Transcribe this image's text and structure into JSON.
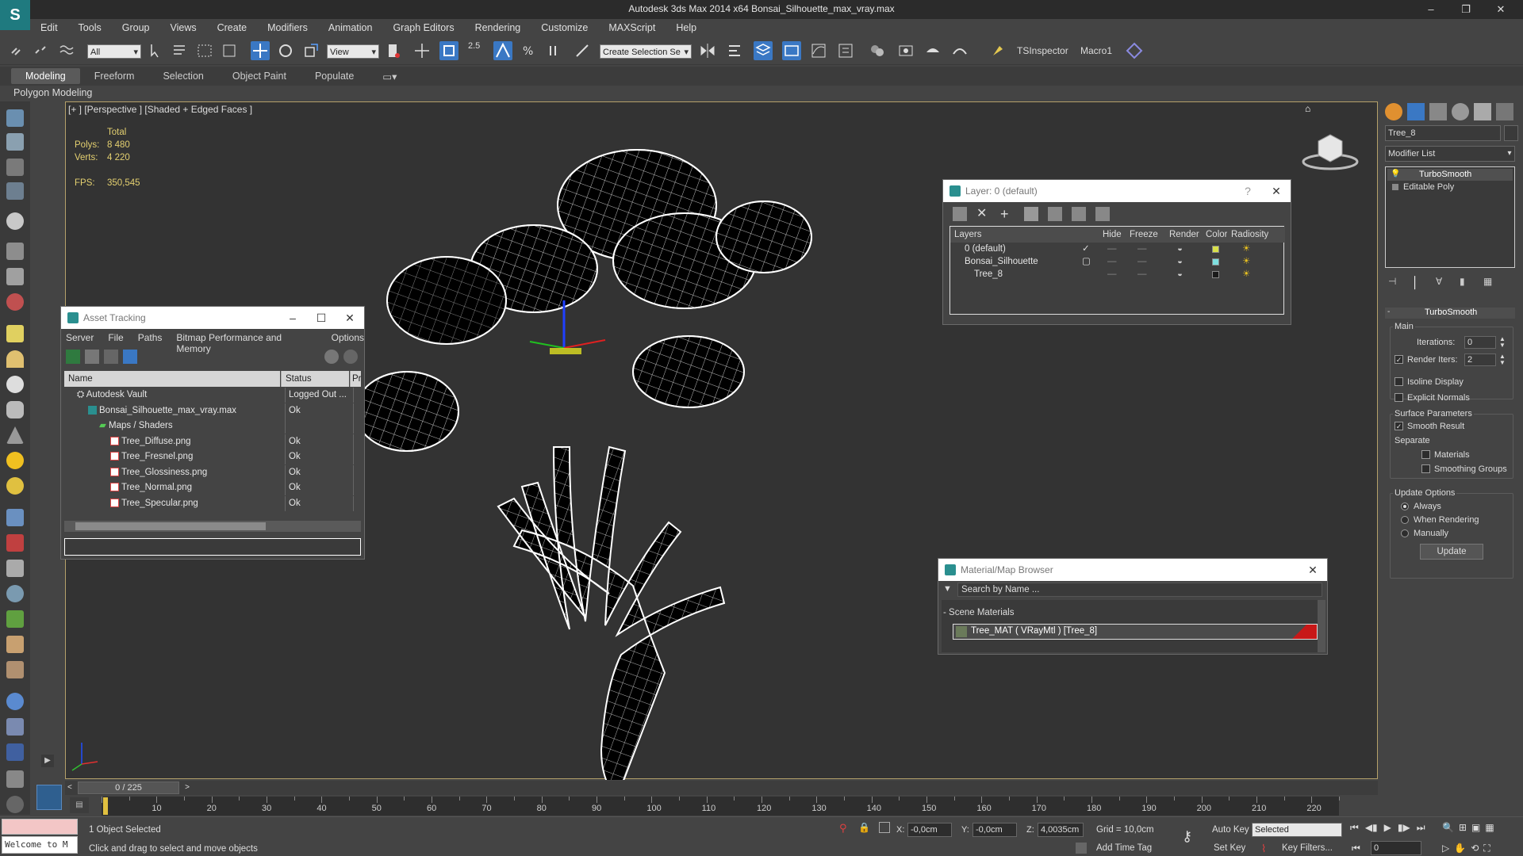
{
  "window": {
    "title": "Autodesk 3ds Max  2014 x64     Bonsai_Silhouette_max_vray.max",
    "minimize": "–",
    "restore": "❐",
    "close": "✕"
  },
  "menu": [
    "Edit",
    "Tools",
    "Group",
    "Views",
    "Create",
    "Modifiers",
    "Animation",
    "Graph Editors",
    "Rendering",
    "Customize",
    "MAXScript",
    "Help"
  ],
  "toolbar": {
    "filter_select": "All",
    "ref_coord_select": "View",
    "snap_label": "2.5",
    "selection_set_placeholder": "Create Selection Se",
    "tsinspector": "TSInspector",
    "macro1": "Macro1"
  },
  "ribbon": {
    "tabs": [
      "Modeling",
      "Freeform",
      "Selection",
      "Object Paint",
      "Populate"
    ],
    "active_tab": "Modeling",
    "sub_label": "Polygon Modeling"
  },
  "viewport": {
    "label": "[+ ] [Perspective ] [Shaded + Edged Faces ]",
    "stats": {
      "total_label": "Total",
      "polys_label": "Polys:",
      "polys_value": "8 480",
      "verts_label": "Verts:",
      "verts_value": "4 220",
      "fps_label": "FPS:",
      "fps_value": "350,545"
    }
  },
  "asset_tracking": {
    "title": "Asset Tracking",
    "menu": [
      "Server",
      "File",
      "Paths",
      "Bitmap Performance and Memory",
      "Options"
    ],
    "columns": [
      "Name",
      "Status",
      "Pr"
    ],
    "rows": [
      {
        "name": "Autodesk Vault",
        "status": "Logged Out ...",
        "indent": 0
      },
      {
        "name": "Bonsai_Silhouette_max_vray.max",
        "status": "Ok",
        "indent": 1
      },
      {
        "name": "Maps / Shaders",
        "status": "",
        "indent": 2
      },
      {
        "name": "Tree_Diffuse.png",
        "status": "Ok",
        "indent": 3
      },
      {
        "name": "Tree_Fresnel.png",
        "status": "Ok",
        "indent": 3
      },
      {
        "name": "Tree_Glossiness.png",
        "status": "Ok",
        "indent": 3
      },
      {
        "name": "Tree_Normal.png",
        "status": "Ok",
        "indent": 3
      },
      {
        "name": "Tree_Specular.png",
        "status": "Ok",
        "indent": 3
      }
    ]
  },
  "layer_window": {
    "title": "Layer: 0 (default)",
    "help": "?",
    "columns": [
      "Layers",
      "Hide",
      "Freeze",
      "Render",
      "Color",
      "Radiosity"
    ],
    "rows": [
      {
        "name": "0 (default)",
        "color": "#d8e04a",
        "indent": 1
      },
      {
        "name": "Bonsai_Silhouette",
        "color": "#7fe0e0",
        "indent": 1
      },
      {
        "name": "Tree_8",
        "color": "#1a1a1a",
        "indent": 2
      }
    ]
  },
  "material_browser": {
    "title": "Material/Map Browser",
    "search_placeholder": "Search by Name ...",
    "section": "- Scene Materials",
    "material": "Tree_MAT ( VRayMtl ) [Tree_8]"
  },
  "command_panel": {
    "object_name": "Tree_8",
    "modifier_list": "Modifier List",
    "stack": [
      "TurboSmooth",
      "Editable Poly"
    ],
    "rollout_title": "TurboSmooth",
    "main_label": "Main",
    "iterations_label": "Iterations:",
    "iterations_value": "0",
    "render_iters_label": "Render Iters:",
    "render_iters_value": "2",
    "isoline_label": "Isoline Display",
    "explicit_normals_label": "Explicit Normals",
    "surface_params_label": "Surface Parameters",
    "smooth_result_label": "Smooth Result",
    "separate_label": "Separate",
    "materials_label": "Materials",
    "smoothing_groups_label": "Smoothing Groups",
    "update_options_label": "Update Options",
    "always_label": "Always",
    "when_rendering_label": "When Rendering",
    "manually_label": "Manually",
    "update_button": "Update"
  },
  "timeline": {
    "slider": "0 / 225",
    "ticks": [
      "10",
      "20",
      "30",
      "40",
      "50",
      "60",
      "70",
      "80",
      "90",
      "100",
      "110",
      "120",
      "130",
      "140",
      "150",
      "160",
      "170",
      "180",
      "190",
      "200",
      "210",
      "220"
    ]
  },
  "status": {
    "maxscript_listener": "Welcome to M",
    "selection_info": "1 Object Selected",
    "prompt": "Click and drag to select and move objects",
    "x_label": "X:",
    "x_value": "-0,0cm",
    "y_label": "Y:",
    "y_value": "-0,0cm",
    "z_label": "Z:",
    "z_value": "4,0035cm",
    "grid": "Grid = 10,0cm",
    "add_time_tag": "Add Time Tag",
    "auto_key": "Auto Key",
    "set_key": "Set Key",
    "selected_select": "Selected",
    "key_filters": "Key Filters...",
    "frame_value": "0"
  },
  "colors": {
    "accent_blue": "#3a78c4",
    "viewport_bg": "#333333",
    "stat_yellow": "#e4d070"
  }
}
